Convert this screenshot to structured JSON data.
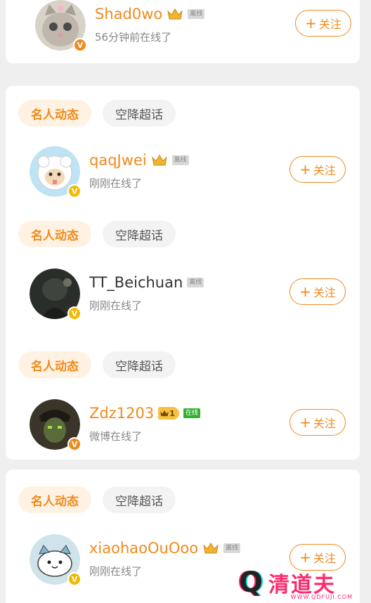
{
  "follow_label": "关注",
  "tags": {
    "active": "名人动态",
    "inactive": "空降超话"
  },
  "accent_color": "#f08a1c",
  "users": [
    {
      "name": "Shad0wo",
      "status": "56分钟前在线了",
      "presence": "离线",
      "verified": "orange"
    },
    {
      "name": "qaqJwei",
      "status": "刚刚在线了",
      "presence": "离线",
      "verified": "yellow"
    },
    {
      "name": "TT_Beichuan",
      "status": "刚刚在线了",
      "presence": "离线",
      "verified": "yellow"
    },
    {
      "name": "Zdz1203",
      "status": "微博在线了",
      "presence": "在线",
      "level": "1",
      "verified": "orange"
    },
    {
      "name": "xiaohaoOuOoo",
      "status": "刚刚在线了",
      "presence": "离线",
      "verified": "yellow"
    }
  ],
  "watermark": {
    "letter": "Q",
    "text": "清道夫",
    "url": "WWW.QDFUJI.COM"
  }
}
